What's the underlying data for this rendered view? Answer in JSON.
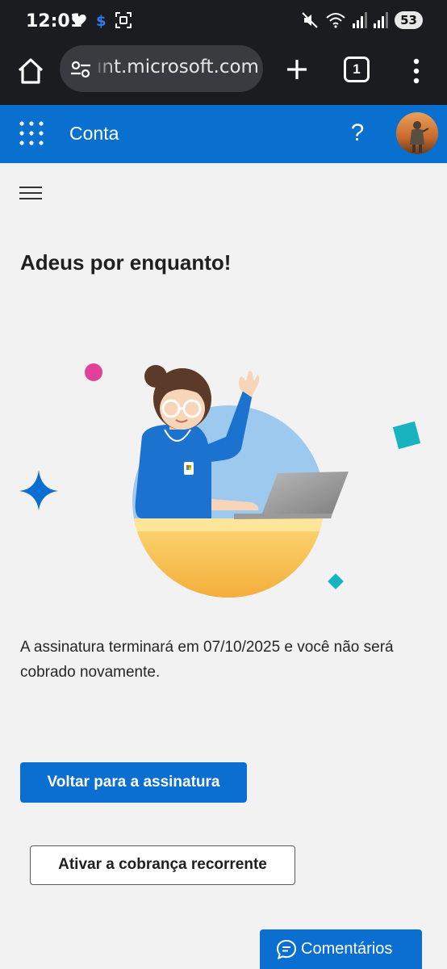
{
  "status_bar": {
    "time": "12:01",
    "battery": "53"
  },
  "browser": {
    "url": "ınt.microsoft.com",
    "tab_count": "1"
  },
  "header": {
    "title": "Conta",
    "help": "?"
  },
  "main": {
    "title": "Adeus por enquanto!",
    "message": "A assinatura terminará em 07/10/2025 e você não será cobrado novamente.",
    "primary_button": "Voltar para a assinatura",
    "secondary_button": "Ativar a cobrança recorrente",
    "feedback_button": "Comentários"
  },
  "colors": {
    "brand_blue": "#0a70d0",
    "browser_dark": "#1b1c20"
  }
}
